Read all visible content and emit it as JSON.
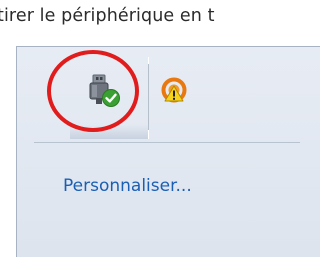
{
  "tooltip": {
    "text": "tirer le périphérique en t"
  },
  "tray": {
    "icons": [
      {
        "name": "usb-safe-remove-icon",
        "highlighted": true,
        "annotation": "red-circle"
      },
      {
        "name": "warning-speaker-icon",
        "highlighted": false
      }
    ],
    "customize_label": "Personnaliser..."
  },
  "colors": {
    "annotation": "#e01c1c",
    "link": "#1a5fb4",
    "panel": "#e3e9f1"
  }
}
